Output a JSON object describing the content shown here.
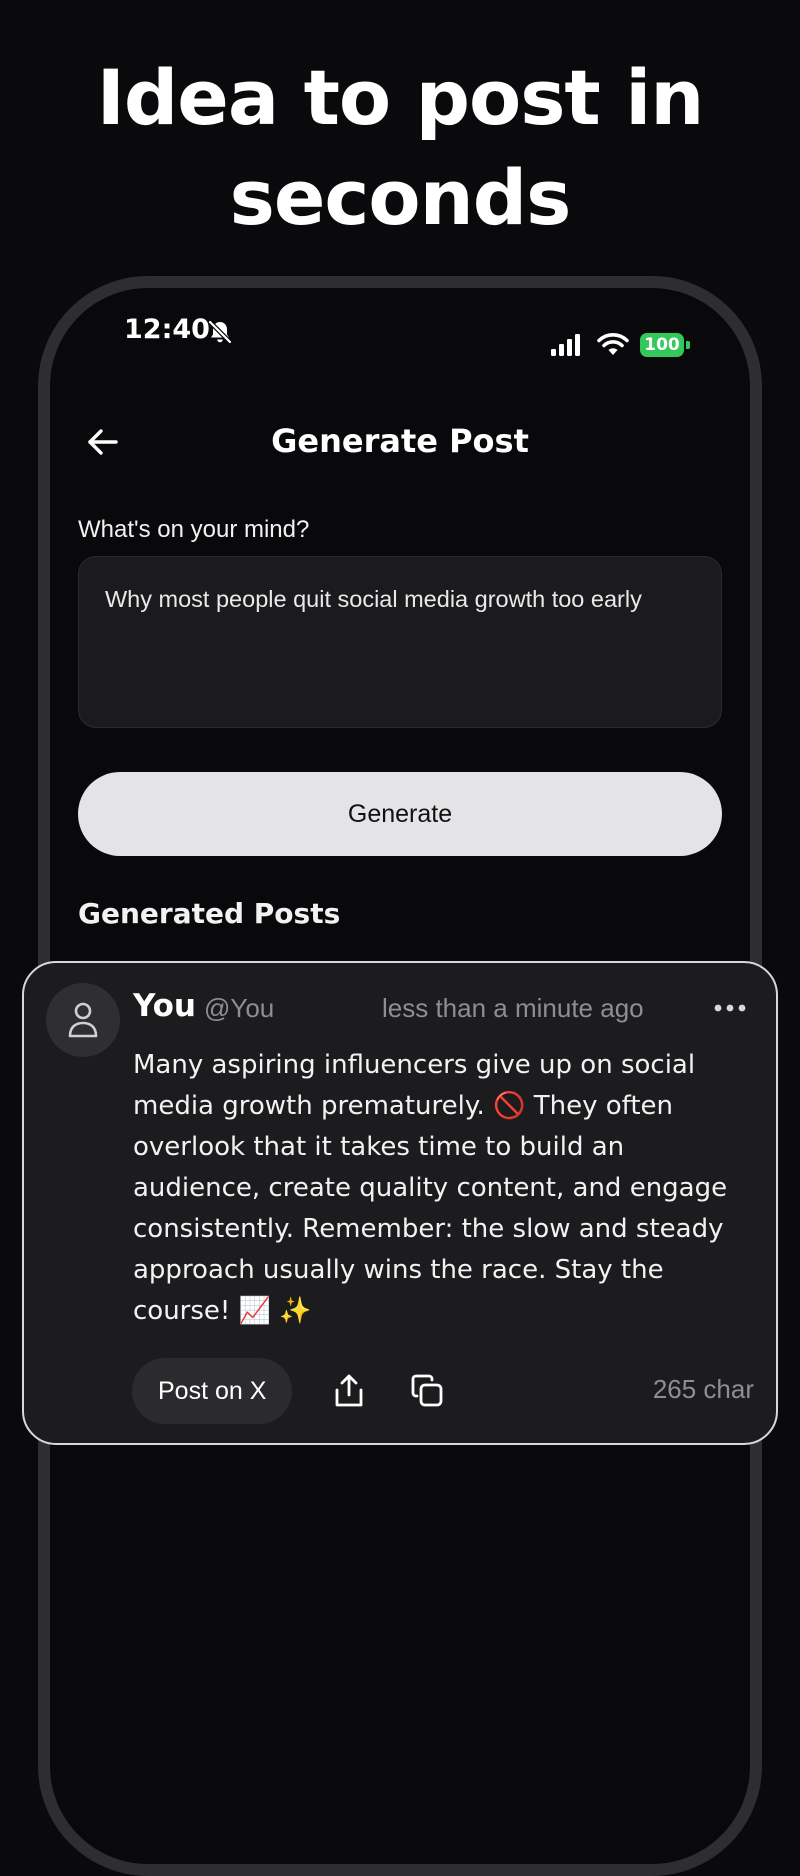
{
  "headline": {
    "line1": "Idea to post in",
    "line2": "seconds"
  },
  "status_bar": {
    "time": "12:40",
    "battery": "100",
    "icons": [
      "bell-slash-icon",
      "cellular-signal-icon",
      "wifi-icon",
      "battery-icon"
    ],
    "battery_color": "#34c759"
  },
  "nav": {
    "back_icon": "arrow-left-icon",
    "title": "Generate Post"
  },
  "prompt": {
    "label": "What's on your mind?",
    "value": "Why most people quit social media growth too early"
  },
  "generate_button": {
    "label": "Generate"
  },
  "generated_section": {
    "title": "Generated Posts"
  },
  "post": {
    "author_name": "You",
    "author_handle": "@You",
    "time": "less than a minute ago",
    "text": "Many aspiring influencers give up on social media growth prematurely. 🚫 They often overlook that it takes time to build an audience, create quality content, and engage consistently. Remember: the slow and steady approach usually wins the race. Stay the course! 📈 ✨",
    "post_button": "Post on X",
    "char_count": "265 char",
    "icons": [
      "user-icon",
      "more-icon",
      "share-icon",
      "copy-icon"
    ]
  },
  "colors": {
    "background": "#0a0a0c",
    "card": "#1c1c1e",
    "secondary_text": "#8e8e93",
    "button_light": "#e4e4e6"
  }
}
